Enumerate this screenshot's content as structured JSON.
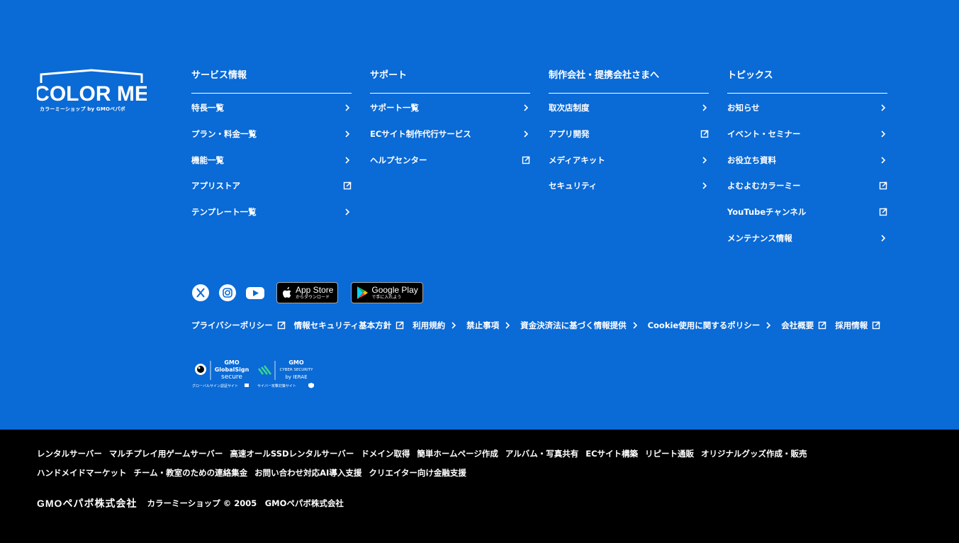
{
  "brand": {
    "logo_text": "COLOR ME",
    "logo_sub": "カラーミーショップ by GMOペパボ"
  },
  "columns": [
    {
      "title": "サービス情報",
      "items": [
        {
          "label": "特長一覧",
          "icon": "chevron-right-icon"
        },
        {
          "label": "プラン・料金一覧",
          "icon": "chevron-right-icon"
        },
        {
          "label": "機能一覧",
          "icon": "chevron-right-icon"
        },
        {
          "label": "アプリストア",
          "icon": "external-link-icon"
        },
        {
          "label": "テンプレート一覧",
          "icon": "chevron-right-icon"
        }
      ]
    },
    {
      "title": "サポート",
      "items": [
        {
          "label": "サポート一覧",
          "icon": "chevron-right-icon"
        },
        {
          "label": "ECサイト制作代行サービス",
          "icon": "chevron-right-icon"
        },
        {
          "label": "ヘルプセンター",
          "icon": "external-link-icon"
        }
      ]
    },
    {
      "title": "制作会社・提携会社さまへ",
      "items": [
        {
          "label": "取次店制度",
          "icon": "chevron-right-icon"
        },
        {
          "label": "アプリ開発",
          "icon": "external-link-icon"
        },
        {
          "label": "メディアキット",
          "icon": "chevron-right-icon"
        },
        {
          "label": "セキュリティ",
          "icon": "chevron-right-icon"
        }
      ]
    },
    {
      "title": "トピックス",
      "items": [
        {
          "label": "お知らせ",
          "icon": "chevron-right-icon"
        },
        {
          "label": "イベント・セミナー",
          "icon": "chevron-right-icon"
        },
        {
          "label": "お役立ち資料",
          "icon": "chevron-right-icon"
        },
        {
          "label": "よむよむカラーミー",
          "icon": "external-link-icon"
        },
        {
          "label": "YouTubeチャンネル",
          "icon": "external-link-icon"
        },
        {
          "label": "メンテナンス情報",
          "icon": "chevron-right-icon"
        }
      ]
    }
  ],
  "social": {
    "icons": [
      "x-icon",
      "instagram-icon",
      "youtube-icon"
    ],
    "app_store": {
      "big": "App Store",
      "small": "からダウンロード"
    },
    "google_play": {
      "big": "Google Play",
      "small": "で手に入れよう"
    }
  },
  "policy_links": [
    {
      "label": "プライバシーポリシー",
      "icon": "external-link-icon"
    },
    {
      "label": "情報セキュリティ基本方針",
      "icon": "external-link-icon"
    },
    {
      "label": "利用規約",
      "icon": "chevron-right-icon"
    },
    {
      "label": "禁止事項",
      "icon": "chevron-right-icon"
    },
    {
      "label": "資金決済法に基づく情報提供",
      "icon": "chevron-right-icon"
    },
    {
      "label": "Cookie使用に関するポリシー",
      "icon": "chevron-right-icon"
    },
    {
      "label": "会社概要",
      "icon": "external-link-icon"
    },
    {
      "label": "採用情報",
      "icon": "external-link-icon"
    }
  ],
  "security_badges": {
    "globalsign": {
      "top": "GMO",
      "name": "GlobalSign",
      "sub": "secure",
      "caption": "グローバルサイン認証サイト"
    },
    "ierae": {
      "top": "GMO",
      "name": "CYBER SECURITY",
      "sub": "by IERAE",
      "caption": "サイバー攻撃対策サイト"
    }
  },
  "services_row1": [
    "レンタルサーバー",
    "マルチプレイ用ゲームサーバー",
    "高速オールSSDレンタルサーバー",
    "ドメイン取得",
    "簡単ホームページ作成",
    "アルバム・写真共有",
    "ECサイト構築",
    "リピート通販",
    "オリジナルグッズ作成・販売"
  ],
  "services_row2": [
    "ハンドメイドマーケット",
    "チーム・教室のための連絡集金",
    "お問い合わせ対応AI導入支援",
    "クリエイター向け金融支援"
  ],
  "copyright": {
    "company_logo": "GMOペパボ株式会社",
    "text": "カラーミーショップ © 2005　GMOペパボ株式会社"
  },
  "colors": {
    "top_bg": "#0a6ad6",
    "bottom_bg": "#000000",
    "text": "#ffffff"
  }
}
